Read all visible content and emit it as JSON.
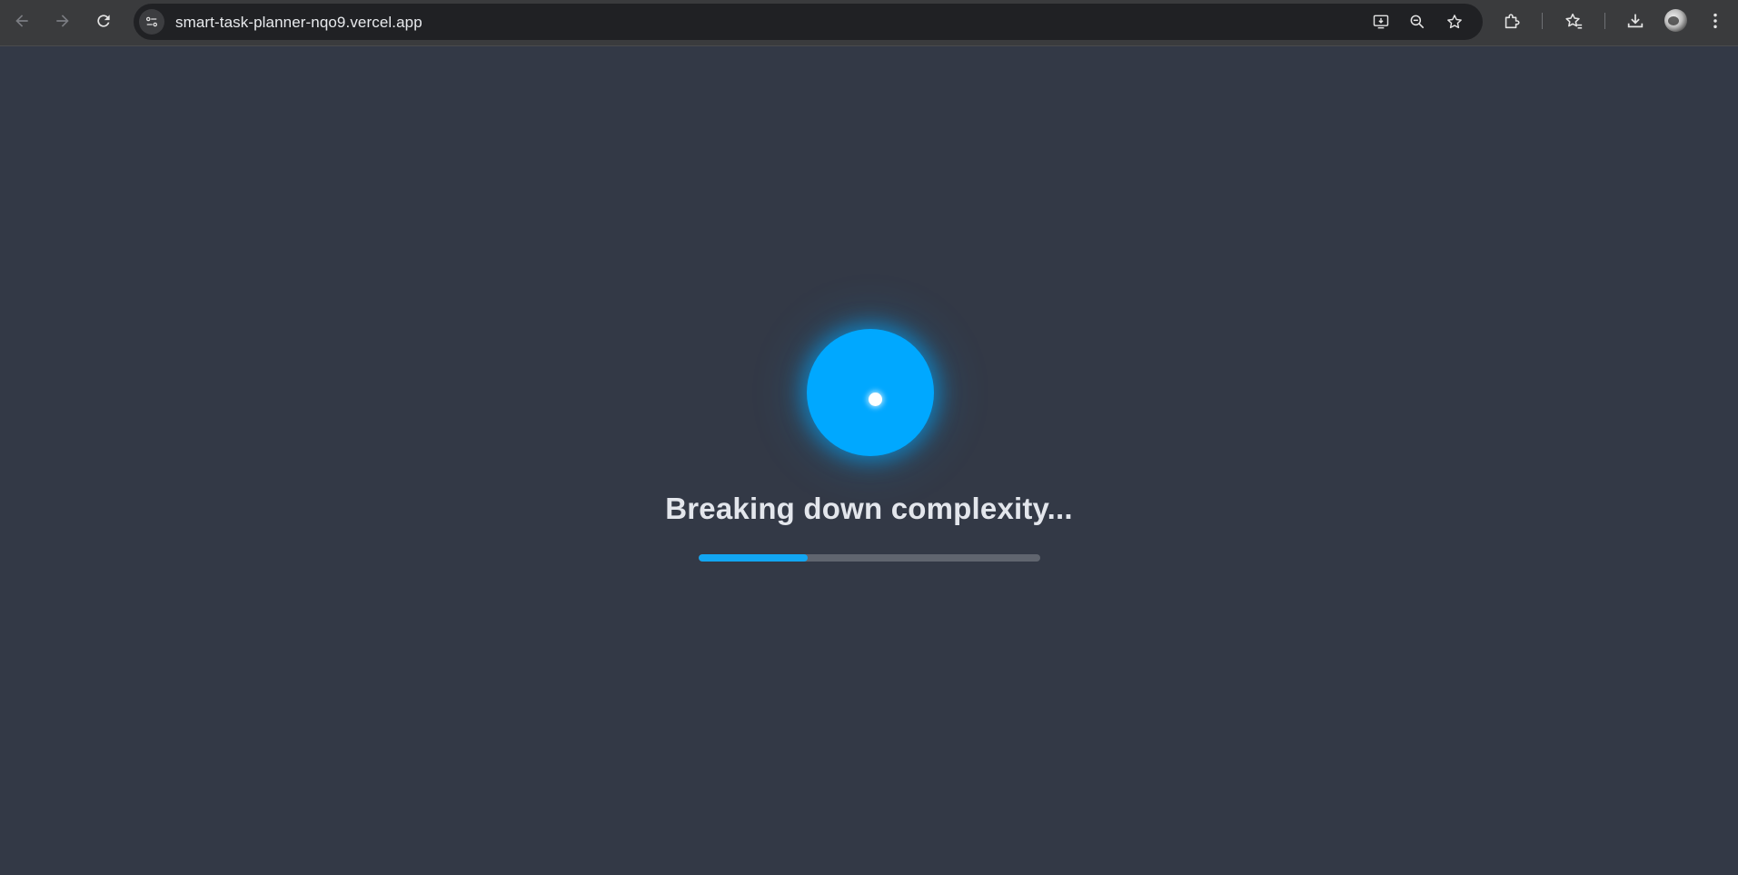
{
  "browser": {
    "url": "smart-task-planner-nqo9.vercel.app",
    "icons": {
      "back": "arrow-left-icon",
      "forward": "arrow-right-icon",
      "reload": "reload-icon",
      "site_info": "tune-icon",
      "install": "install-app-icon",
      "zoom": "zoom-out-icon",
      "bookmark": "star-icon",
      "extensions": "puzzle-icon",
      "bookmarks_manager": "star-list-icon",
      "downloads": "download-icon",
      "profile": "avatar",
      "menu": "kebab-menu-icon"
    }
  },
  "loader": {
    "status_text": "Breaking down complexity...",
    "progress": 0.32,
    "accent_color": "#00a8ff",
    "track_color": "#60656f",
    "background_color": "#333946"
  }
}
